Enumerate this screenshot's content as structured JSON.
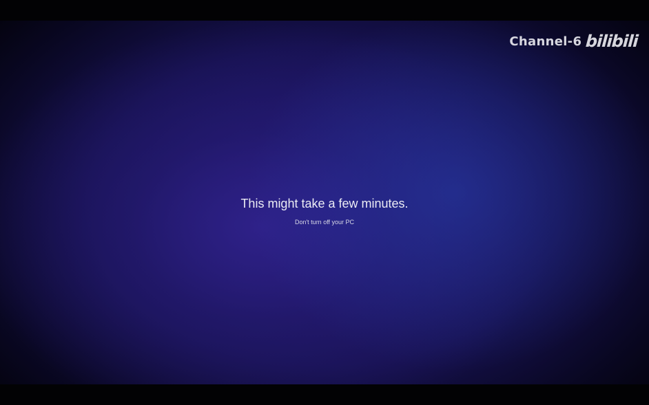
{
  "screen": {
    "headline": "This might take a few minutes.",
    "subtext": "Don't turn off your PC"
  },
  "watermark": {
    "channel": "Channel-6",
    "logo_text": "bilibili"
  },
  "colors": {
    "background_center": "#231a78",
    "background_edge": "#04030f",
    "text": "#ececf4"
  }
}
